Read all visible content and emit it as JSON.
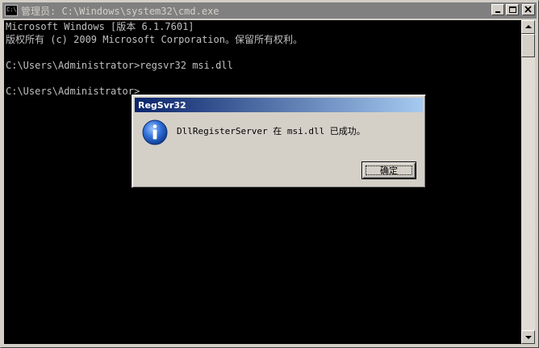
{
  "window": {
    "title": "管理员: C:\\Windows\\system32\\cmd.exe",
    "icon": "cmd-icon"
  },
  "console": {
    "lines": [
      "Microsoft Windows [版本 6.1.7601]",
      "版权所有 (c) 2009 Microsoft Corporation。保留所有权利。",
      "",
      "C:\\Users\\Administrator>regsvr32 msi.dll",
      "",
      "C:\\Users\\Administrator>"
    ]
  },
  "dialog": {
    "title": "RegSvr32",
    "icon": "information-icon",
    "message": "DllRegisterServer 在 msi.dll 已成功。",
    "ok_label": "确定"
  },
  "colors": {
    "console_bg": "#000000",
    "console_fg": "#c0c0c0",
    "titlebar_inactive": "#808080",
    "dialog_title_start": "#0a246a",
    "dialog_title_end": "#a6caf0",
    "info_blue": "#1f5fc8"
  }
}
